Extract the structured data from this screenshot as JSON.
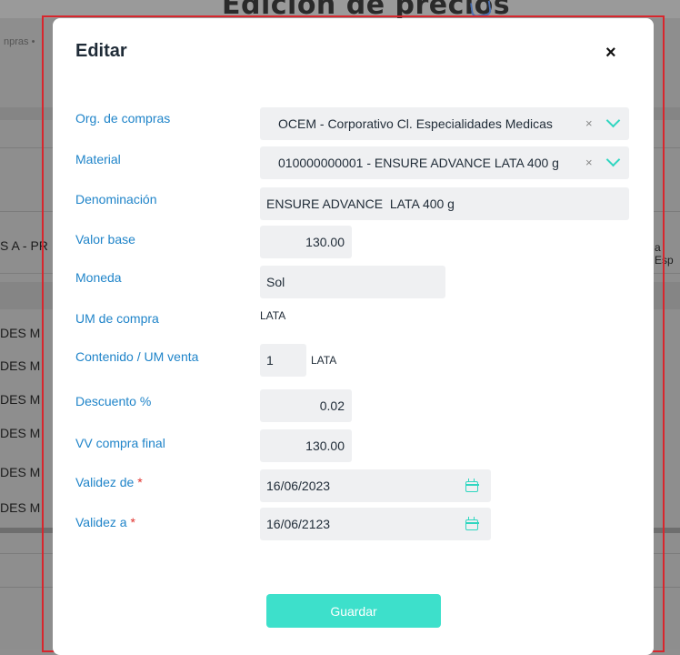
{
  "background": {
    "page_title": "Edicion de precios",
    "breadcrumb": "npras •",
    "left_cells": [
      "S A - PR",
      "DES M",
      "DES M",
      "DES M",
      "DES M",
      "DES M",
      "DES M"
    ],
    "right_cell": "a Esp"
  },
  "modal": {
    "title": "Editar",
    "close_label": "×",
    "fields": {
      "org_compras": {
        "label": "Org. de compras",
        "value": "OCEM - Corporativo Cl. Especialidades Medicas",
        "clear": "×"
      },
      "material": {
        "label": "Material",
        "value": "010000000001 - ENSURE ADVANCE LATA 400 g",
        "clear": "×"
      },
      "denominacion": {
        "label": "Denominación",
        "value": "ENSURE ADVANCE  LATA 400 g"
      },
      "valor_base": {
        "label": "Valor base",
        "value": "130.00"
      },
      "moneda": {
        "label": "Moneda",
        "value": "Sol"
      },
      "um_compra": {
        "label": "UM de compra",
        "value": "LATA"
      },
      "contenido": {
        "label": "Contenido / UM venta",
        "value": "1",
        "unit": "LATA"
      },
      "descuento": {
        "label": "Descuento %",
        "value": "0.02"
      },
      "vv_compra": {
        "label": "VV compra final",
        "value": "130.00"
      },
      "validez_de": {
        "label": "Validez de",
        "required": "*",
        "value": "16/06/2023"
      },
      "validez_a": {
        "label": "Validez a",
        "required": "*",
        "value": "16/06/2123"
      }
    },
    "save_label": "Guardar"
  },
  "colors": {
    "accent": "#3de0cb",
    "label": "#1f84c9",
    "required": "#e0312c",
    "frame": "#d8262d"
  }
}
